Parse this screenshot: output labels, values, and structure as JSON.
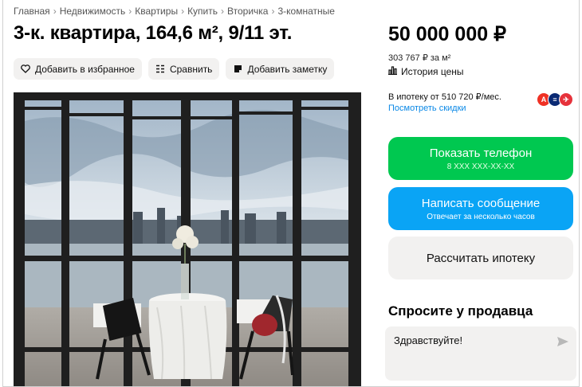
{
  "breadcrumbs": [
    "Главная",
    "Недвижимость",
    "Квартиры",
    "Купить",
    "Вторичка",
    "3-комнатные"
  ],
  "listing": {
    "title": "3-к. квартира, 164,6 м², 9/11 эт.",
    "price": "50 000 000 ₽",
    "price_per_m2": "303 767 ₽ за м²",
    "price_history": "История цены",
    "mortgage_text": "В ипотеку от 510 720 ₽/мес.",
    "discounts_link": "Посмотреть скидки"
  },
  "actions": {
    "favorite": "Добавить в избранное",
    "compare": "Сравнить",
    "note": "Добавить заметку"
  },
  "contact": {
    "show_phone": "Показать телефон",
    "phone_mask": "8 XXX XXX-XX-XX",
    "write_message": "Написать сообщение",
    "reply_time": "Отвечает за несколько часов",
    "calc_mortgage": "Рассчитать ипотеку"
  },
  "ask_seller": {
    "title": "Спросите у продавца",
    "value": "Здравствуйте!"
  },
  "banks": [
    {
      "icon": "alfa-bank-icon",
      "color": "#ef3124",
      "glyph": "А"
    },
    {
      "icon": "vtb-bank-icon",
      "color": "#0a2973",
      "glyph": "≡"
    },
    {
      "icon": "sovcombank-icon",
      "color": "#e6323b",
      "glyph": "✈"
    }
  ],
  "colors": {
    "accent_green": "#00c850",
    "accent_blue": "#0aa4f5",
    "link_blue": "#0a88e6",
    "button_grey": "#f2f1f0"
  }
}
